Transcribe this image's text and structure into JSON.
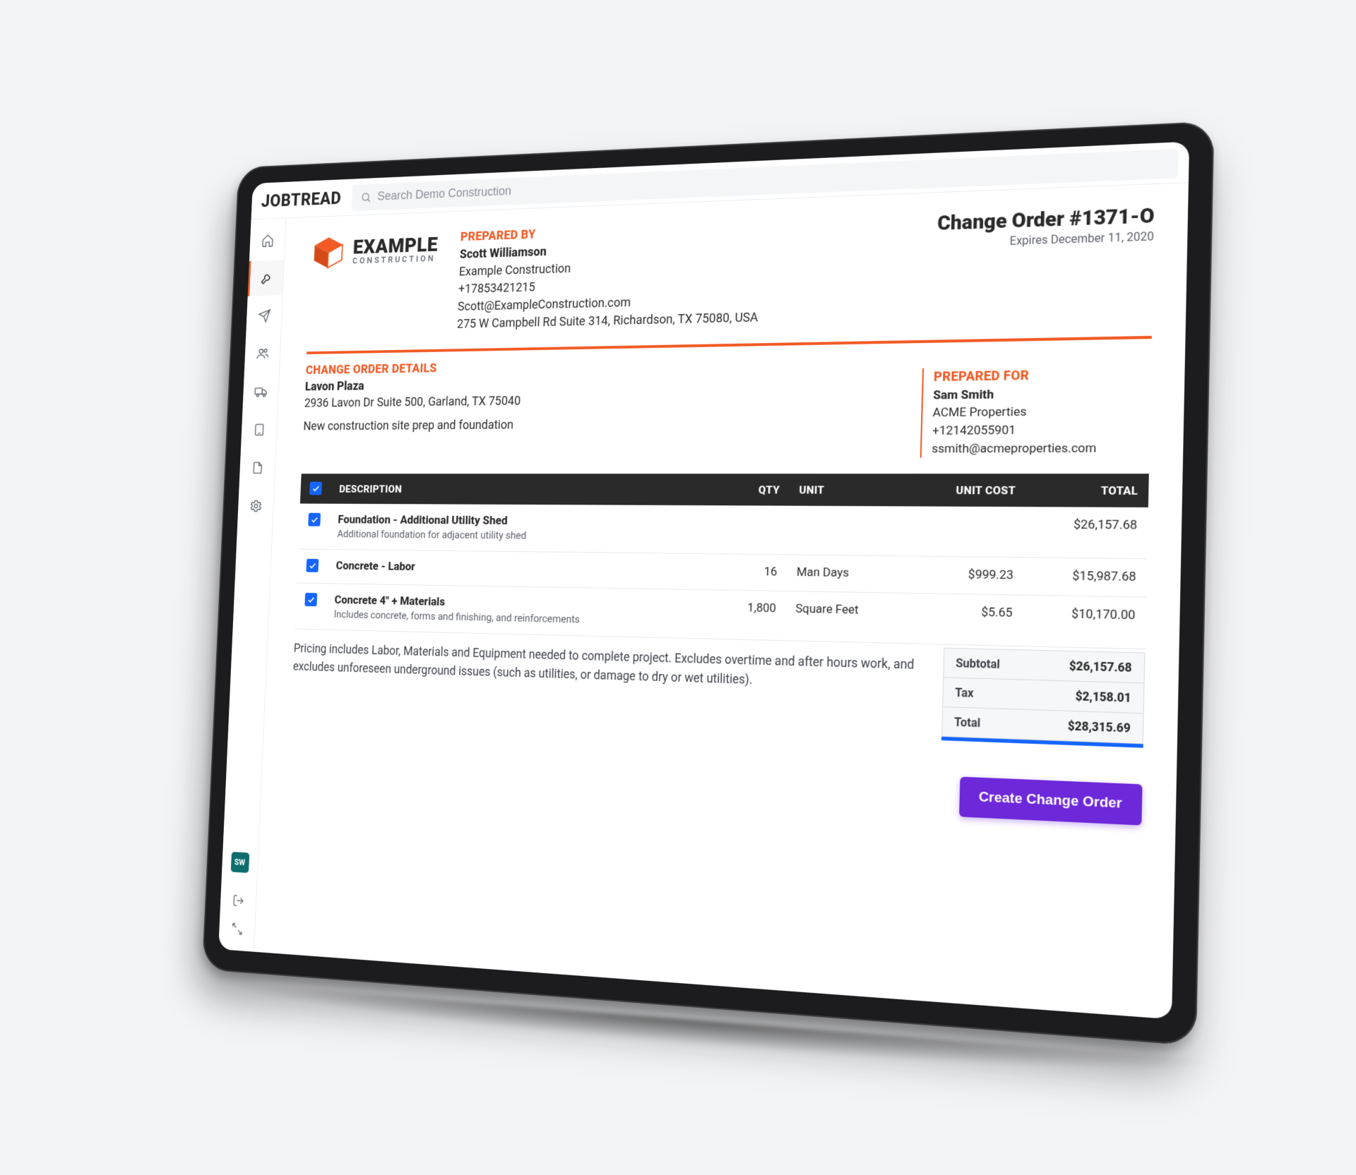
{
  "brand": {
    "name": "JOBTREAD"
  },
  "search": {
    "placeholder": "Search Demo Construction"
  },
  "sidebar": {
    "avatar_initials": "SW"
  },
  "company": {
    "name": "EXAMPLE",
    "sub": "CONSTRUCTION"
  },
  "prepared_by": {
    "label": "PREPARED BY",
    "name": "Scott Williamson",
    "company": "Example Construction",
    "phone": "+17853421215",
    "email": "Scott@ExampleConstruction.com",
    "address": "275 W Campbell Rd Suite 314, Richardson, TX 75080, USA"
  },
  "doc": {
    "title": "Change Order #1371-O",
    "expires": "Expires December 11, 2020"
  },
  "details": {
    "section_label": "CHANGE ORDER DETAILS",
    "location_name": "Lavon Plaza",
    "location_addr": "2936 Lavon Dr Suite 500, Garland, TX 75040",
    "description": "New construction site prep and foundation"
  },
  "prepared_for": {
    "label": "PREPARED FOR",
    "name": "Sam Smith",
    "company": "ACME Properties",
    "phone": "+12142055901",
    "email": "ssmith@acmeproperties.com"
  },
  "table": {
    "headers": {
      "desc": "DESCRIPTION",
      "qty": "QTY",
      "unit": "UNIT",
      "unit_cost": "UNIT COST",
      "total": "TOTAL"
    },
    "rows": [
      {
        "title": "Foundation - Additional Utility Shed",
        "sub": "Additional foundation for adjacent utility shed",
        "qty": "",
        "unit": "",
        "unit_cost": "",
        "total": "$26,157.68"
      },
      {
        "title": "Concrete - Labor",
        "sub": "",
        "qty": "16",
        "unit": "Man Days",
        "unit_cost": "$999.23",
        "total": "$15,987.68"
      },
      {
        "title": "Concrete 4\" + Materials",
        "sub": "Includes concrete, forms and finishing, and reinforcements",
        "qty": "1,800",
        "unit": "Square Feet",
        "unit_cost": "$5.65",
        "total": "$10,170.00"
      }
    ]
  },
  "footer": {
    "note": "Pricing includes Labor, Materials and Equipment needed to complete project. Excludes overtime and after hours work, and excludes unforeseen underground issues (such as utilities, or damage to dry or wet utilities).",
    "subtotal_label": "Subtotal",
    "subtotal": "$26,157.68",
    "tax_label": "Tax",
    "tax": "$2,158.01",
    "total_label": "Total",
    "total": "$28,315.69"
  },
  "cta": {
    "label": "Create Change Order"
  }
}
